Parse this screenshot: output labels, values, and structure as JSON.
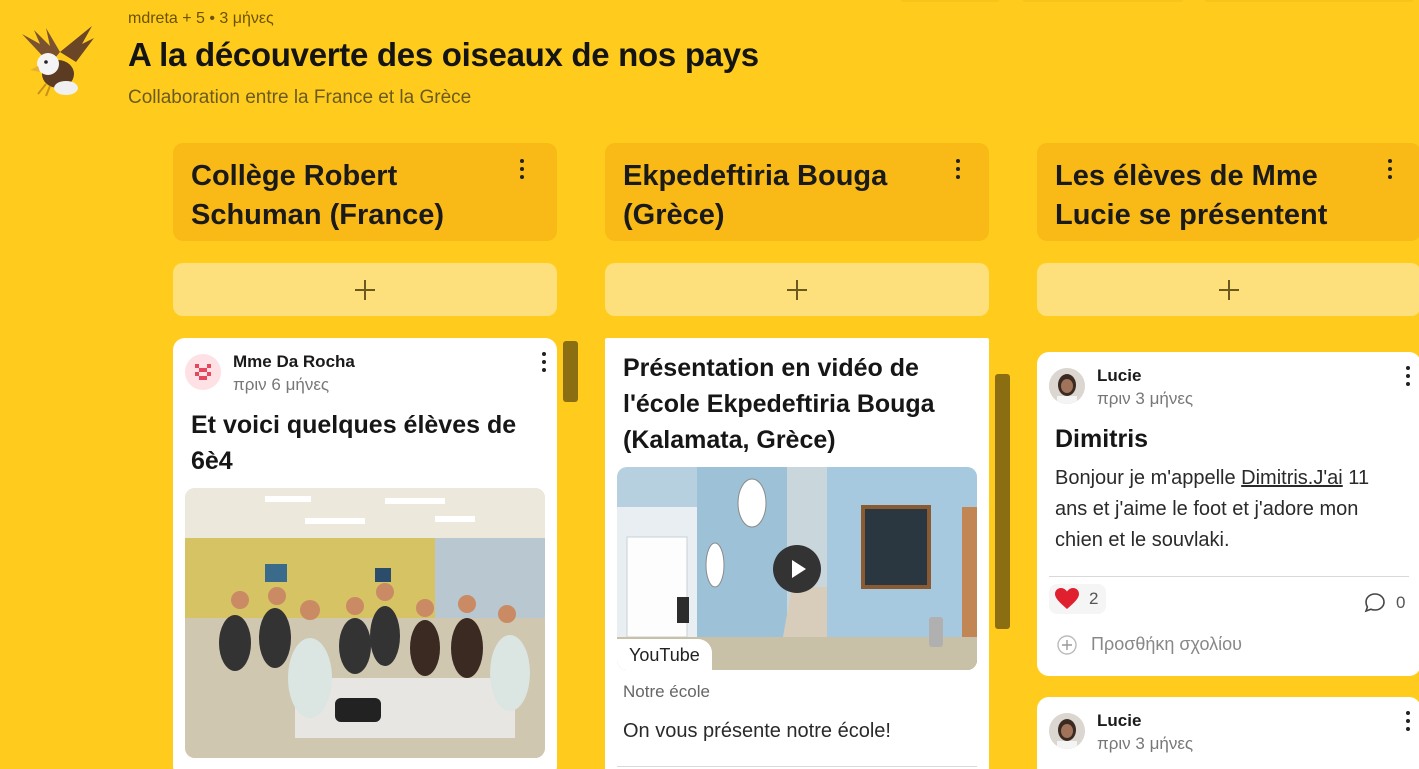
{
  "header": {
    "meta": "mdreta + 5 • 3 μήνες",
    "title": "A la découverte des oiseaux de nos pays",
    "subtitle": "Collaboration entre la France et la Grèce"
  },
  "columns": [
    {
      "title": "Collège Robert Schuman (France)"
    },
    {
      "title": "Ekpedeftiria Bouga (Grèce)"
    },
    {
      "title": "Les élèves de Mme Lucie se présentent"
    }
  ],
  "posts": {
    "p1": {
      "author": "Mme Da Rocha",
      "time": "πριν 6 μήνες",
      "title": "Et voici quelques élèves de 6è4"
    },
    "p2": {
      "title": "Présentation en vidéo de l'école Ekpedeftiria Bouga (Kalamata, Grèce)",
      "source": "YouTube",
      "caption": "Notre école",
      "body": "On vous présente notre école!"
    },
    "p3": {
      "author": "Lucie",
      "time": "πριν 3 μήνες",
      "title": "Dimitris",
      "body_before": "Bonjour je m'appelle ",
      "body_link": "Dimitris.J'ai",
      "body_after": " 11 ans et j'aime le foot et j'adore mon chien et le souvlaki.",
      "likes": "2",
      "comments": "0",
      "add_comment": "Προσθήκη σχολίου"
    },
    "p4": {
      "author": "Lucie",
      "time": "πριν 3 μήνες"
    }
  }
}
